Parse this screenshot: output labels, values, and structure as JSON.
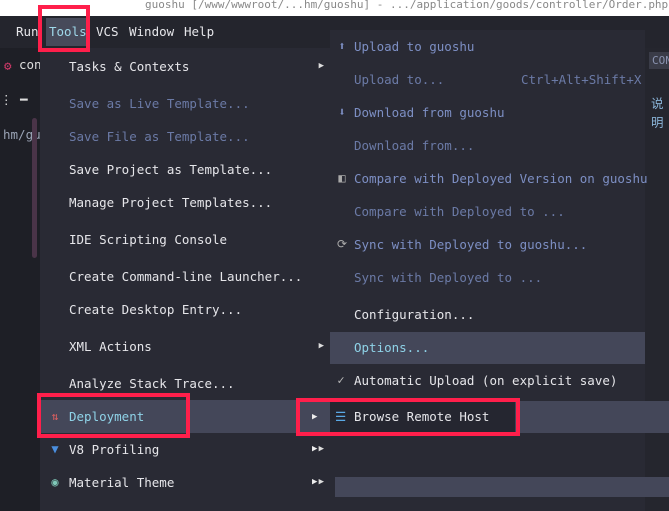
{
  "window_title": "guoshu [/www/wwwroot/...hm/guoshu] - .../application/goods/controller/Order.php - PhpSto",
  "menubar": {
    "items": [
      {
        "label": "Run"
      },
      {
        "label": "Tools"
      },
      {
        "label": "VCS"
      },
      {
        "label": "Window"
      },
      {
        "label": "Help"
      }
    ]
  },
  "left_panel": {
    "tab": "conf",
    "path": "hm/gu"
  },
  "right_panel": {
    "badge": "CON",
    "text": "说明"
  },
  "tools_menu": {
    "items": [
      {
        "label": "Tasks & Contexts",
        "submenu": true
      },
      {
        "label": "Save as Live Template...",
        "disabled": true
      },
      {
        "label": "Save File as Template...",
        "disabled": true
      },
      {
        "label": "Save Project as Template..."
      },
      {
        "label": "Manage Project Templates..."
      },
      {
        "label": "IDE Scripting Console"
      },
      {
        "label": "Create Command-line Launcher..."
      },
      {
        "label": "Create Desktop Entry..."
      },
      {
        "label": "XML Actions",
        "submenu": true
      },
      {
        "label": "Analyze Stack Trace..."
      },
      {
        "label": "Deployment",
        "submenu": true,
        "highlighted": true,
        "icon": "deployment-arrows-icon"
      },
      {
        "label": "V8 Profiling",
        "submenu": true,
        "icon": "v8-icon"
      },
      {
        "label": "Material Theme",
        "submenu": true,
        "icon": "material-theme-icon"
      }
    ]
  },
  "deployment_menu": {
    "items": [
      {
        "label": "Upload to guoshu",
        "icon": "upload-icon"
      },
      {
        "label": "Upload to...",
        "shortcut": "Ctrl+Alt+Shift+X",
        "disabled": true
      },
      {
        "label": "Download from guoshu",
        "icon": "download-icon"
      },
      {
        "label": "Download from...",
        "disabled": true
      },
      {
        "label": "Compare with Deployed Version on guoshu",
        "icon": "compare-icon"
      },
      {
        "label": "Compare with Deployed to ...",
        "disabled": true
      },
      {
        "label": "Sync with Deployed to guoshu...",
        "icon": "sync-icon"
      },
      {
        "label": "Sync with Deployed to ...",
        "disabled": true
      },
      {
        "label": "Configuration..."
      },
      {
        "label": "Options...",
        "highlighted": true
      },
      {
        "label": "Automatic Upload (on explicit save)",
        "checked": true
      }
    ]
  },
  "browse_item": {
    "label": "Browse Remote Host",
    "icon": "server-icon"
  },
  "colors": {
    "highlight_box": "#ff1f4b",
    "selection": "#444759",
    "menu_bg": "#292a34",
    "accent_text": "#8fd3e8"
  }
}
